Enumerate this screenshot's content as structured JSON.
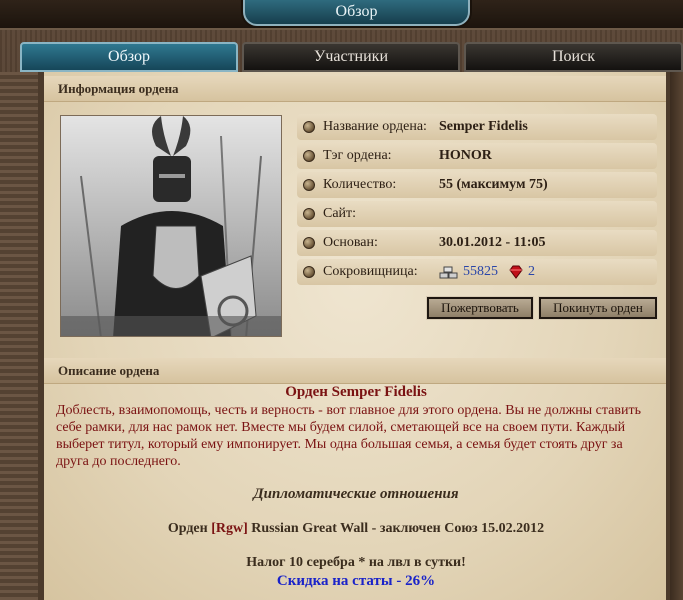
{
  "window": {
    "title": "Обзор"
  },
  "tabs": [
    {
      "label": "Обзор",
      "active": true
    },
    {
      "label": "Участники",
      "active": false
    },
    {
      "label": "Поиск",
      "active": false
    }
  ],
  "info": {
    "header": "Информация ордена",
    "rows": [
      {
        "label": "Название ордена:",
        "value": "Semper Fidelis"
      },
      {
        "label": "Тэг ордена:",
        "value": "HONOR"
      },
      {
        "label": "Количество:",
        "value": "55 (максимум 75)"
      },
      {
        "label": "Сайт:",
        "value": ""
      },
      {
        "label": "Основан:",
        "value": "30.01.2012 - 11:05"
      },
      {
        "label": "Сокровищница:",
        "value": ""
      }
    ],
    "treasury": {
      "silver": "55825",
      "gems": "2",
      "silver_icon": "silver-bars-icon",
      "gem_icon": "ruby-icon"
    },
    "buttons": {
      "donate": "Пожертвовать",
      "leave": "Покинуть орден"
    }
  },
  "description": {
    "header": "Описание ордена",
    "title": "Орден Semper Fidelis",
    "text": "Доблесть, взаимопомощь, честь и верность - вот главное для этого ордена. Вы не должны ставить себе рамки, для нас рамок нет. Вместе мы будем силой, сметающей все на своем пути. Каждый выберет титул, который ему импонирует. Мы одна большая семья, а семья будет стоять друг за друга до последнего.",
    "diplomacy_title": "Дипломатические отношения",
    "alliance_prefix": "Орден ",
    "alliance_tag": "[Rgw]",
    "alliance_rest": " Russian Great Wall - заключен Союз 15.02.2012",
    "tax": "Налог 10 серебра * на лвл в сутки!",
    "discount": "Скидка на статы  - 26%"
  },
  "colors": {
    "accent": "#2f7890",
    "text_red": "#7a1212",
    "link_blue": "#2a45a8",
    "discount_blue": "#1a23c9"
  }
}
